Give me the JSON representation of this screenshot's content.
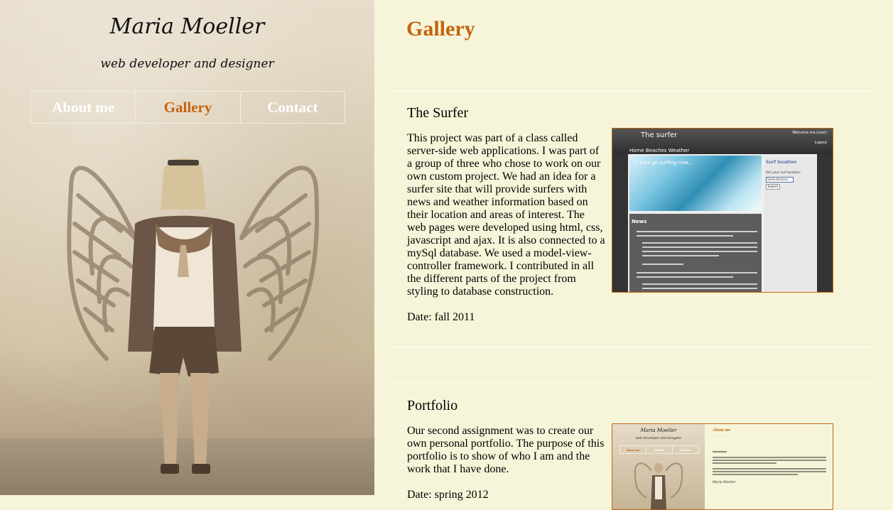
{
  "sidebar": {
    "name": "Maria Moeller",
    "tagline": "web developer and designer",
    "nav": [
      {
        "label": "About me",
        "active": false
      },
      {
        "label": "Gallery",
        "active": true
      },
      {
        "label": "Contact",
        "active": false
      }
    ]
  },
  "main": {
    "page_title": "Gallery",
    "projects": [
      {
        "title": "The Surfer",
        "description": "This project was part of a class called server-side web applications. I was part of a group of three who chose to work on our own custom project. We had an idea for a surfer site that will provide surfers with news and weather information based on their location and areas of interest. The web pages were developed using html, css, javascript and ajax. It is also connected to a mySql database. We used a model-view-controller framework. I contributed in all the different parts of the project from styling to database construction.",
        "date": "Date: fall 2011",
        "thumbnail": {
          "site_title": "The surfer",
          "welcome": "Welcome ma (user)",
          "logout": "Logout",
          "menu": "Home  Beaches  Weather",
          "banner_text": "» Lets go surfing now...",
          "news_heading": "News",
          "side_title": "Surf location",
          "side_label": "Set your surf location:",
          "select_value": "Santa Barbara",
          "submit": "Submit"
        }
      },
      {
        "title": "Portfolio",
        "description": "Our second assignment was to create our own personal portfolio. The purpose of this portfolio is to show of who I am and the work that I have done.",
        "date": "Date: spring 2012",
        "thumbnail": {
          "name": "Maria Moeller",
          "tagline": "web developer and designer",
          "nav": [
            "About me",
            "Gallery",
            "Contact"
          ],
          "heading": "About me",
          "signature": "Maria Moeller"
        }
      }
    ]
  },
  "colors": {
    "accent": "#c4640f",
    "background": "#f6f5d9",
    "sidebar_tone": "#ddd0b8"
  }
}
